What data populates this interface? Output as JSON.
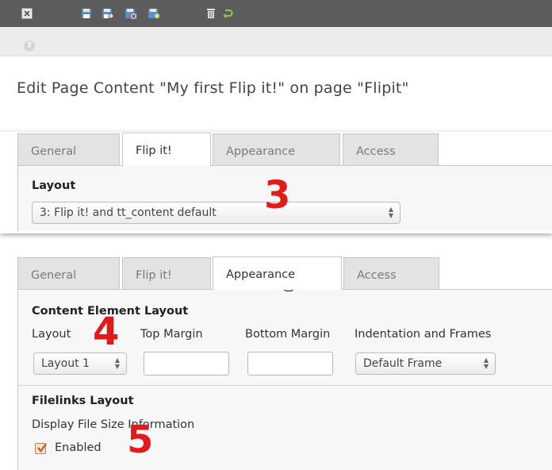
{
  "toolbar": {
    "icons": [
      "close-icon",
      "save-icon",
      "save-view-icon",
      "save-close-icon",
      "save-new-icon",
      "delete-icon",
      "undo-icon"
    ]
  },
  "help": {
    "glyph": "?"
  },
  "page_title": "Edit Page Content \"My first Flip it!\" on page \"Flipit\"",
  "panel1": {
    "tabs": [
      "General",
      "Flip it!",
      "Appearance",
      "Access"
    ],
    "active_tab": "Flip it!",
    "layout_label": "Layout",
    "layout_value": "3: Flip it! and tt_content default",
    "annotation": "3"
  },
  "panel2": {
    "tabs": [
      "General",
      "Flip it!",
      "Appearance",
      "Access"
    ],
    "active_tab": "Appearance",
    "section_title": "Content Element Layout",
    "fields": {
      "layout_label": "Layout",
      "top_margin_label": "Top Margin",
      "bottom_margin_label": "Bottom Margin",
      "indentation_label": "Indentation and Frames"
    },
    "layout_value": "Layout 1",
    "top_margin_value": "",
    "bottom_margin_value": "",
    "frame_value": "Default Frame",
    "filelinks_title": "Filelinks Layout",
    "display_file_size_label": "Display File Size Information",
    "enabled_label": "Enabled",
    "enabled_checked": true,
    "annotation_layout": "4",
    "annotation_filelinks": "5"
  },
  "colors": {
    "toolbar_bg": "#5c5c5c",
    "annotation_red": "#e11a1a",
    "icon_blue": "#5b8ec9",
    "icon_green": "#8bc34a"
  }
}
